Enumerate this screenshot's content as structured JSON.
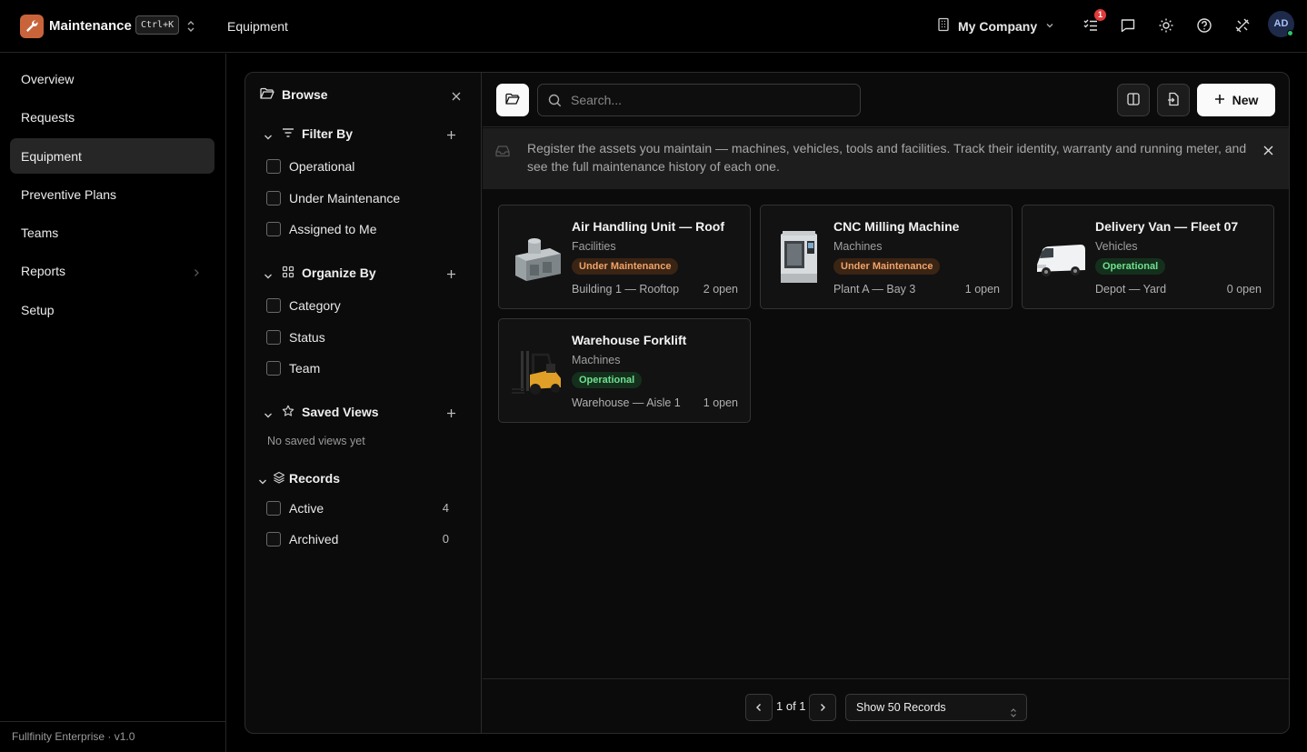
{
  "app": {
    "name": "Maintenance",
    "shortcut": "Ctrl+K",
    "page": "Equipment"
  },
  "header": {
    "company": "My Company",
    "notification_count": "1",
    "avatar_initials": "AD"
  },
  "sidebar": {
    "items": [
      {
        "label": "Overview"
      },
      {
        "label": "Requests"
      },
      {
        "label": "Equipment",
        "active": true
      },
      {
        "label": "Preventive Plans"
      },
      {
        "label": "Teams"
      },
      {
        "label": "Reports",
        "has_submenu": true
      },
      {
        "label": "Setup"
      }
    ],
    "footer": "Fullfinity Enterprise · v1.0"
  },
  "browse": {
    "title": "Browse",
    "filter_by": {
      "title": "Filter By",
      "options": [
        "Operational",
        "Under Maintenance",
        "Assigned to Me"
      ]
    },
    "organize_by": {
      "title": "Organize By",
      "options": [
        "Category",
        "Status",
        "Team"
      ]
    },
    "saved_views": {
      "title": "Saved Views",
      "empty": "No saved views yet"
    },
    "records": {
      "title": "Records",
      "items": [
        {
          "label": "Active",
          "count": "4"
        },
        {
          "label": "Archived",
          "count": "0"
        }
      ]
    }
  },
  "toolbar": {
    "search_placeholder": "Search...",
    "new_label": "New"
  },
  "banner": {
    "text": "Register the assets you maintain — machines, vehicles, tools and facilities. Track their identity, warranty and running meter, and see the full maintenance history of each one."
  },
  "equipment": [
    {
      "name": "Air Handling Unit — Roof",
      "category": "Facilities",
      "status": "Under Maintenance",
      "location": "Building 1 — Rooftop",
      "open": "2 open",
      "icon": "hvac-unit-image"
    },
    {
      "name": "CNC Milling Machine",
      "category": "Machines",
      "status": "Under Maintenance",
      "location": "Plant A — Bay 3",
      "open": "1 open",
      "icon": "cnc-machine-image"
    },
    {
      "name": "Delivery Van — Fleet 07",
      "category": "Vehicles",
      "status": "Operational",
      "location": "Depot — Yard",
      "open": "0 open",
      "icon": "van-image"
    },
    {
      "name": "Warehouse Forklift",
      "category": "Machines",
      "status": "Operational",
      "location": "Warehouse — Aisle 1",
      "open": "1 open",
      "icon": "forklift-image"
    }
  ],
  "pagination": {
    "page_text": "1 of 1",
    "page_size_label": "Show 50 Records"
  },
  "colors": {
    "accent_logo": "#c9643a",
    "badge_maintenance": "#f0a36a",
    "badge_operational": "#6fe08e",
    "notification": "#e23b3b"
  }
}
